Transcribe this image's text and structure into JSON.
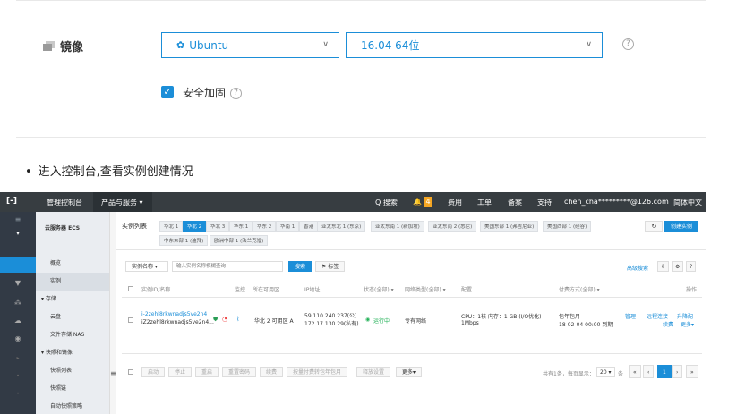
{
  "image_section": {
    "label": "镜像",
    "os_select": {
      "value": "Ubuntu",
      "icon": "ubuntu-icon"
    },
    "version_select": {
      "value": "16.04 64位"
    }
  },
  "security": {
    "label": "安全加固",
    "checked": true
  },
  "bullet": "进入控制台,查看实例创建情况",
  "console": {
    "topbar": {
      "logo": "[-]",
      "console_link": "管理控制台",
      "products": "产品与服务 ▾",
      "search": "Q 搜索",
      "notif_count": "4",
      "items": [
        "费用",
        "工单",
        "备案",
        "支持"
      ],
      "user": "chen_cha*********@126.com",
      "lang": "简体中文"
    },
    "sidebar_title": "云服务器 ECS",
    "sidebar_items": [
      "概览",
      "实例",
      "▾ 存储",
      "云盘",
      "文件存储 NAS",
      "▾ 快照和镜像",
      "快照列表",
      "快照链",
      "自动快照策略"
    ],
    "list_title": "实例列表",
    "regions_row1": [
      "华北 1",
      "华北 2",
      "华北 3",
      "华东 1",
      "华东 2",
      "华南 1",
      "香港",
      "亚太东北 1 (东京)",
      "亚太东南 1 (新加坡)",
      "亚太东南 2 (悉尼)",
      "美国东部 1 (弗吉尼亚)",
      "美国西部 1 (硅谷)"
    ],
    "regions_row2": [
      "中东东部 1 (迪拜)",
      "欧洲中部 1 (法兰克福)"
    ],
    "create_button": "创建实例",
    "refresh_icon": "refresh-icon",
    "filter": {
      "select": "实例名称",
      "placeholder": "输入实例名称模糊查询",
      "search_btn": "搜索",
      "tag_btn": "标签",
      "adv": "高级搜索"
    },
    "table_headers": [
      "实例ID/名称",
      "监控",
      "所在可用区",
      "IP地址",
      "状态(全部) ▾",
      "网络类型(全部) ▾",
      "配置",
      "付费方式(全部) ▾",
      "操作"
    ],
    "row": {
      "id": "i-2ze...o2",
      "id_full": "i-2zehl8rkwnadjs5ve2n4",
      "name": "iZ2zehl8rkwnadjs5ve2n4...",
      "zone": "华北 2 可用区 A",
      "ip_public": "59.110.240.237(公)",
      "ip_private": "172.17.130.29(私有)",
      "status": "运行中",
      "network": "专有网络",
      "config_line1": "CPU：1核  内存：1 GB (I/O优化)",
      "config_line2": "1Mbps",
      "billing_line1": "包年包月",
      "billing_line2": "18-02-04 00:00 到期",
      "actions_line1": [
        "管理",
        "远程连接",
        "升降配"
      ],
      "actions_line2": [
        "续费",
        "更多▾"
      ]
    },
    "bottom_buttons": [
      "启动",
      "停止",
      "重启",
      "重置密码",
      "续费",
      "按量付费转包年包月",
      "释放设置",
      "更多▾"
    ],
    "pager": {
      "summary": "共有1条，每页显示：",
      "per_page": "20 ▾",
      "unit": "条",
      "current": "1"
    }
  },
  "colors": {
    "accent": "#1b8ed8",
    "topbar": "#373d41",
    "sidebar": "#323a45",
    "subsidebar": "#eaedf1",
    "running": "#24b259"
  }
}
